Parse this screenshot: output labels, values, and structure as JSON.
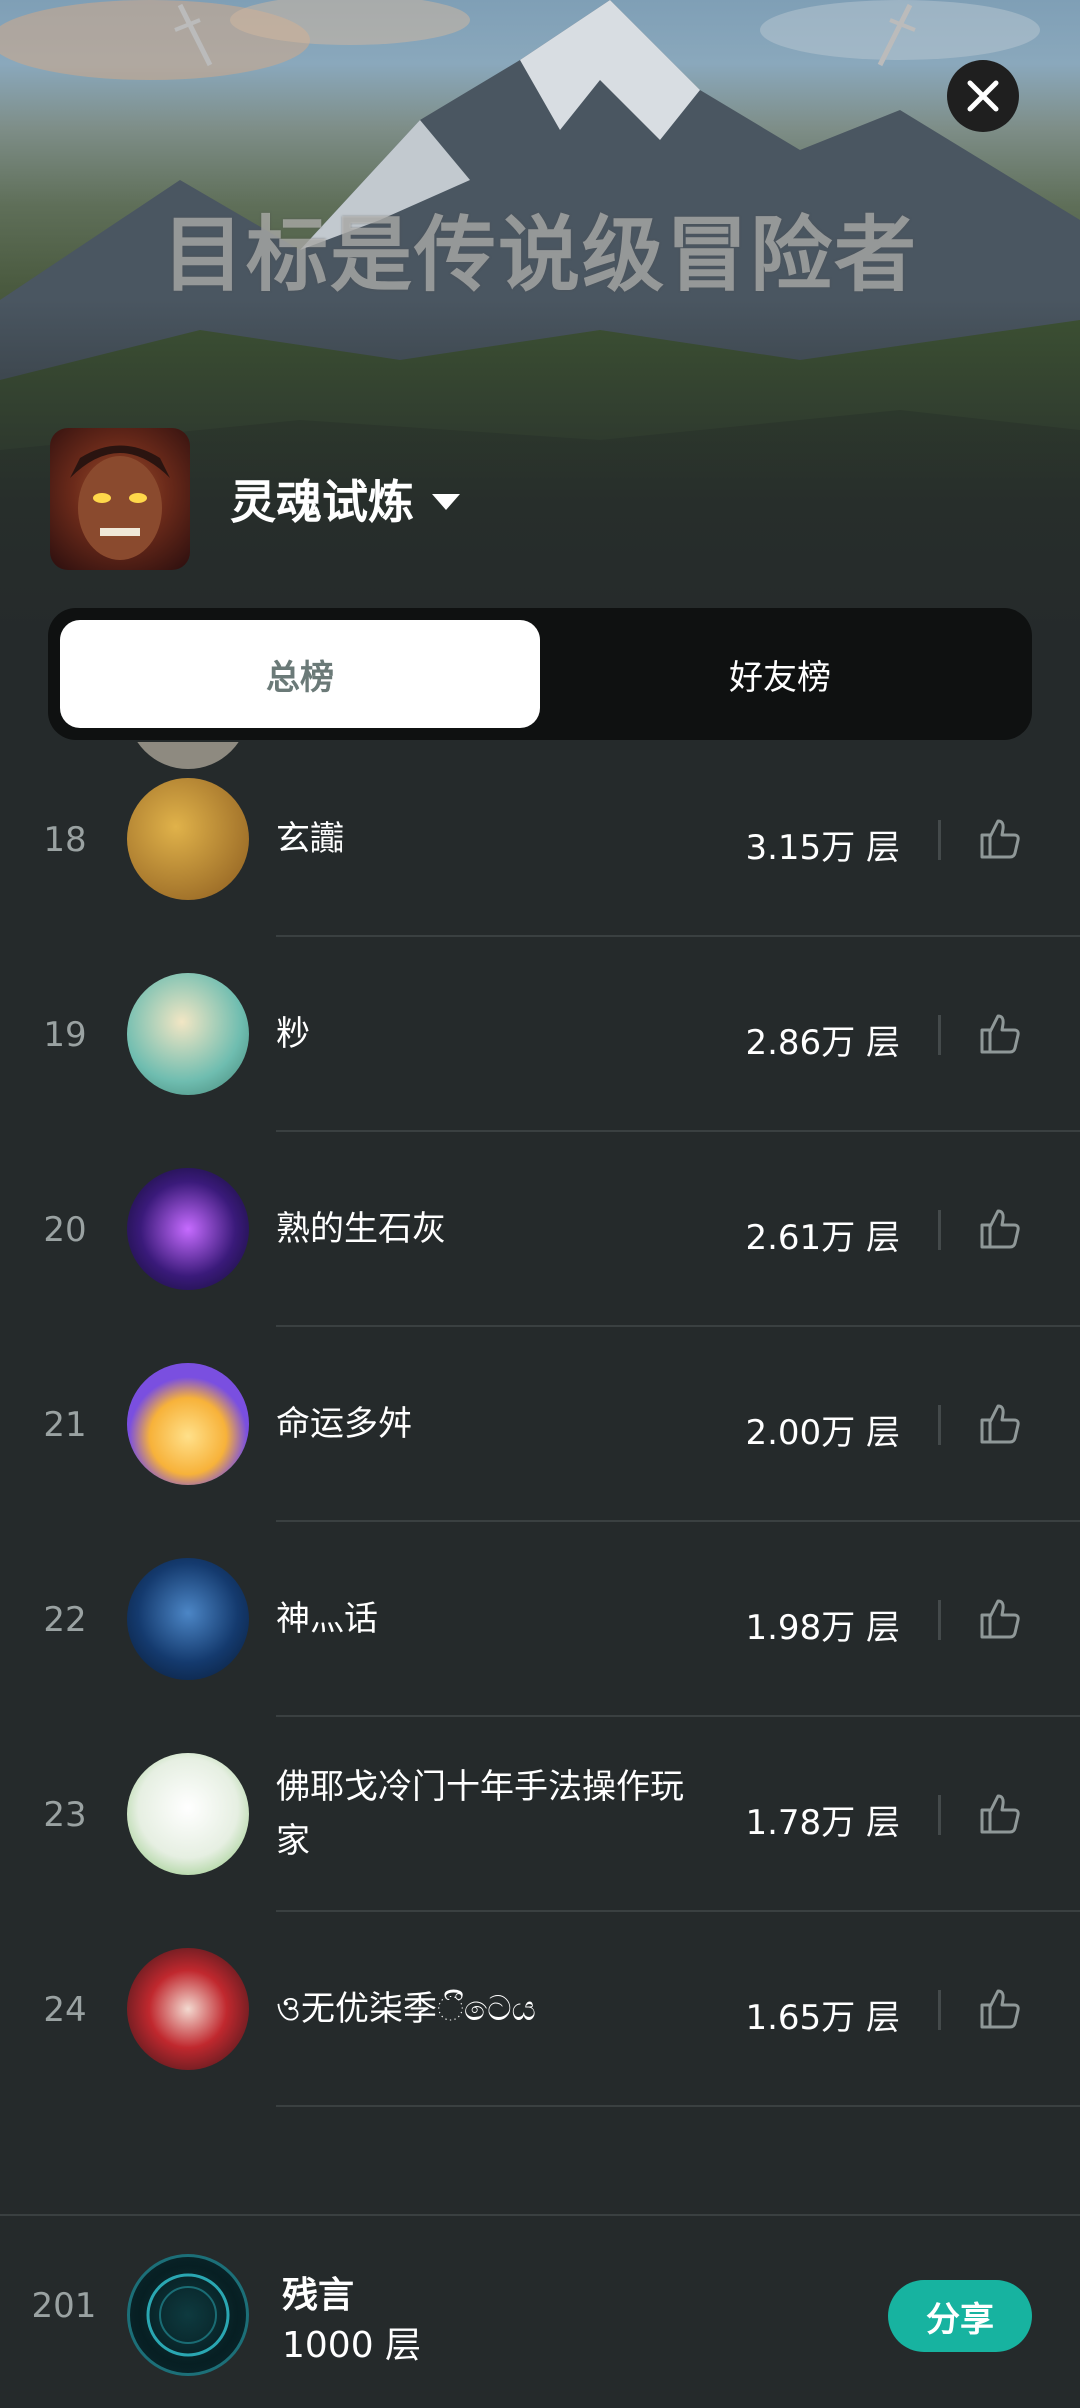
{
  "banner": {
    "title": "目标是传说级冒险者"
  },
  "game": {
    "name": "灵魂试炼"
  },
  "tabs": [
    {
      "label": "总榜",
      "active": true
    },
    {
      "label": "好友榜",
      "active": false
    }
  ],
  "rows": [
    {
      "rank": "18",
      "name": "玄讟",
      "score": "3.15万 层",
      "avatar_color": "#b58a2e"
    },
    {
      "rank": "19",
      "name": "粆",
      "score": "2.86万 层",
      "avatar_color": "#7fc8b8"
    },
    {
      "rank": "20",
      "name": "熟的生石灰",
      "score": "2.61万 层",
      "avatar_color": "#5a2a8a"
    },
    {
      "rank": "21",
      "name": "命运多舛",
      "score": "2.00万 层",
      "avatar_color": "#7b4fe0"
    },
    {
      "rank": "22",
      "name": "神灬话",
      "score": "1.98万 层",
      "avatar_color": "#1a3e70"
    },
    {
      "rank": "23",
      "name": "佛耶戈冷门十年手法操作玩家",
      "score": "1.78万 层",
      "avatar_color": "#e8f0e4"
    },
    {
      "rank": "24",
      "name": "ও无优柒季ීටෙය",
      "score": "1.65万 层",
      "avatar_color": "#3a1e22"
    }
  ],
  "me": {
    "rank": "201",
    "name": "残言",
    "score": "1000 层",
    "share_label": "分享"
  },
  "colors": {
    "accent": "#17b3a0",
    "background": "#252a2b"
  }
}
